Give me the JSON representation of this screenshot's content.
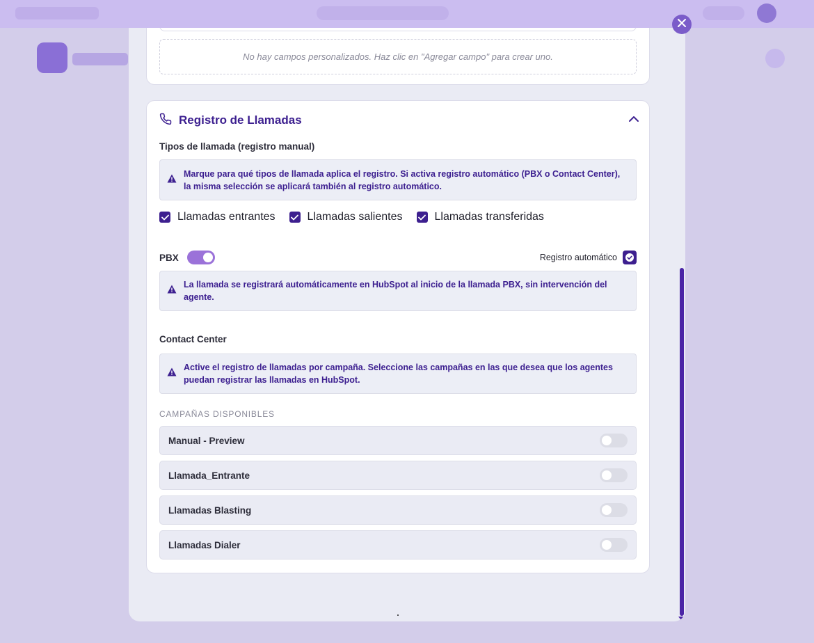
{
  "custom_fields": {
    "empty_message": "No hay campos personalizados. Haz clic en \"Agregar campo\" para crear uno."
  },
  "call_log": {
    "title": "Registro de Llamadas",
    "types_heading": "Tipos de llamada (registro manual)",
    "types_info": "Marque para qué tipos de llamada aplica el registro. Si activa registro automático (PBX o Contact Center), la misma selección se aplicará también al registro automático.",
    "call_types": [
      {
        "label": "Llamadas entrantes",
        "checked": true
      },
      {
        "label": "Llamadas salientes",
        "checked": true
      },
      {
        "label": "Llamadas transferidas",
        "checked": true
      }
    ],
    "pbx": {
      "label": "PBX",
      "enabled": true,
      "auto_label": "Registro automático",
      "auto_checked": true,
      "info": "La llamada se registrará automáticamente en HubSpot al inicio de la llamada PBX, sin intervención del agente."
    },
    "contact_center": {
      "heading": "Contact Center",
      "info": "Active el registro de llamadas por campaña. Seleccione las campañas en las que desea que los agentes puedan registrar las llamadas en HubSpot.",
      "campaigns_label": "CAMPAÑAS DISPONIBLES",
      "campaigns": [
        {
          "name": "Manual - Preview",
          "enabled": false
        },
        {
          "name": "Llamada_Entrante",
          "enabled": false
        },
        {
          "name": "Llamadas Blasting",
          "enabled": false
        },
        {
          "name": "Llamadas Dialer",
          "enabled": false
        }
      ]
    }
  },
  "colors": {
    "accent": "#3d1f8f",
    "toggle_on": "#9b72d9",
    "info_text": "#3d2090"
  }
}
